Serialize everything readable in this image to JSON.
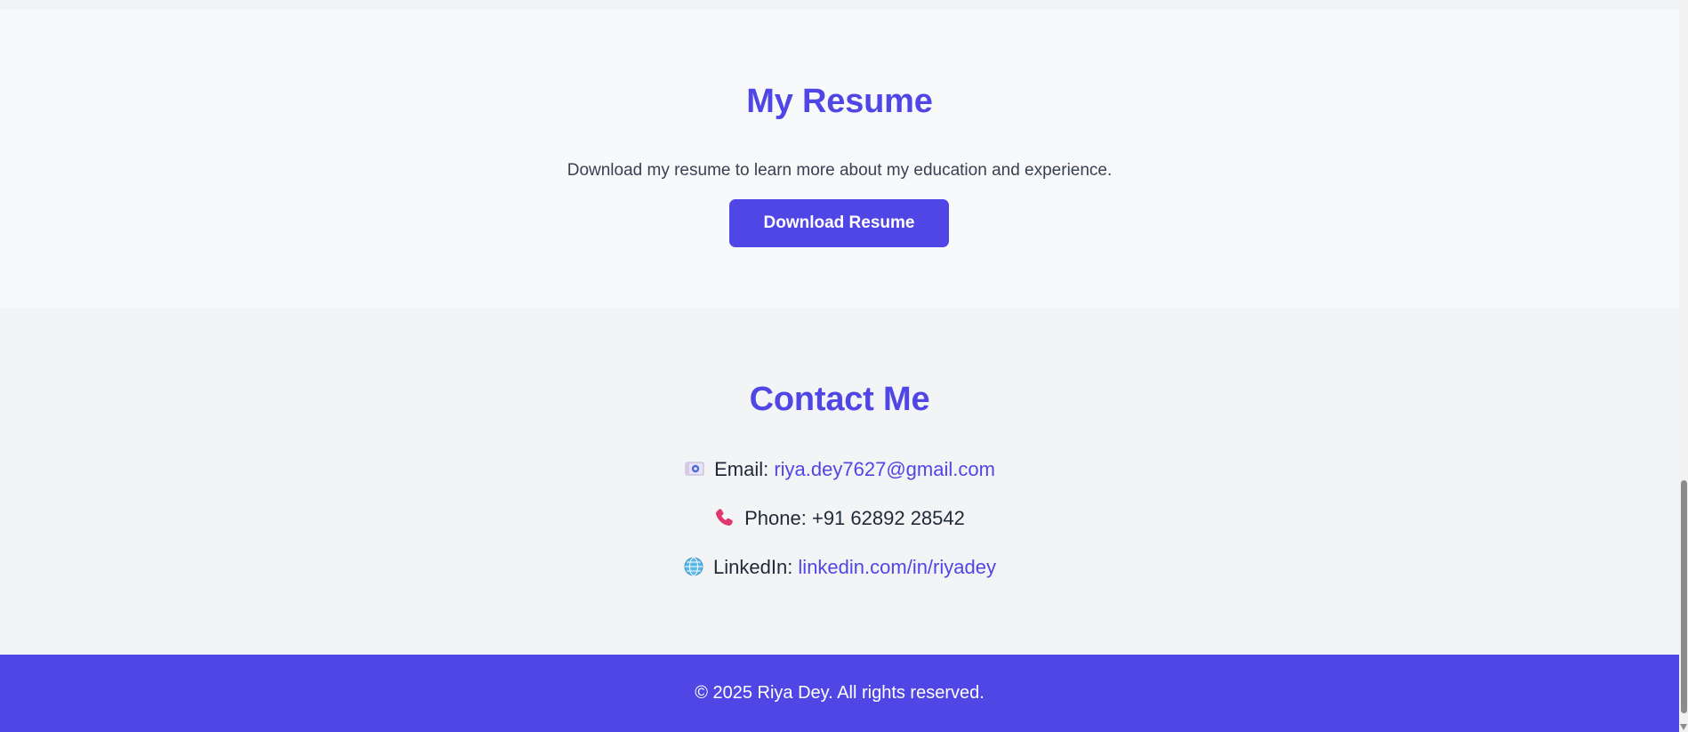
{
  "resume": {
    "title": "My Resume",
    "description": "Download my resume to learn more about my education and experience.",
    "button_label": "Download Resume"
  },
  "contact": {
    "title": "Contact Me",
    "email": {
      "icon": "email-icon",
      "label": "Email:",
      "value": "riya.dey7627@gmail.com"
    },
    "phone": {
      "icon": "phone-icon",
      "label": "Phone:",
      "value": "+91 62892 28542"
    },
    "linkedin": {
      "icon": "globe-icon",
      "label": "LinkedIn:",
      "value": "linkedin.com/in/riyadey"
    }
  },
  "footer": {
    "text": "© 2025 Riya Dey. All rights reserved."
  },
  "colors": {
    "accent": "#4f46e5",
    "resume_background": "#f8f9fb",
    "contact_background": "#f3f4f6",
    "footer_text": "#ffffff",
    "body_text": "#1f2937"
  }
}
